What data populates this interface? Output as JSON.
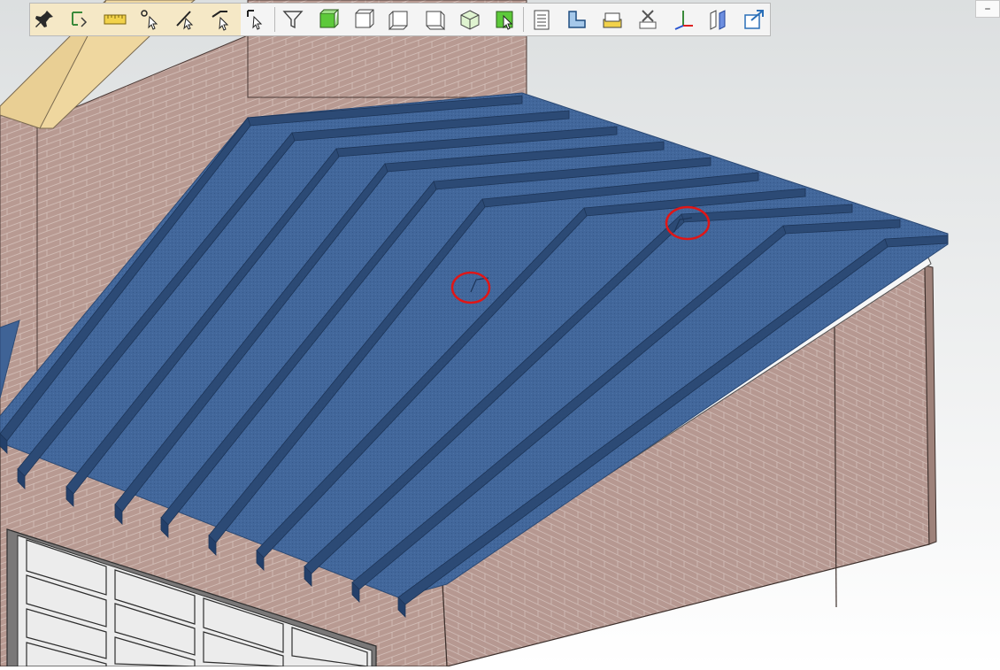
{
  "window": {
    "minimize_label": "–"
  },
  "toolbar": {
    "tools": [
      {
        "id": "pin",
        "icon": "pin-icon"
      },
      {
        "id": "pick-transform",
        "icon": "pick-transform-icon"
      },
      {
        "id": "measure",
        "icon": "ruler-icon"
      },
      {
        "id": "select-point",
        "icon": "select-point-icon"
      },
      {
        "id": "select-edge",
        "icon": "select-edge-icon"
      },
      {
        "id": "select-face",
        "icon": "select-face-icon"
      },
      {
        "id": "select-solid",
        "icon": "select-solid-icon"
      },
      {
        "id": "filter",
        "icon": "filter-icon"
      },
      {
        "id": "view-front",
        "icon": "view-front-icon"
      },
      {
        "id": "view-back",
        "icon": "view-back-icon"
      },
      {
        "id": "view-left",
        "icon": "view-left-icon"
      },
      {
        "id": "view-right",
        "icon": "view-right-icon"
      },
      {
        "id": "view-iso",
        "icon": "view-iso-icon"
      },
      {
        "id": "select-active",
        "icon": "select-active-icon"
      },
      {
        "id": "sheet-list",
        "icon": "sheet-list-icon"
      },
      {
        "id": "stair-section",
        "icon": "section-icon"
      },
      {
        "id": "layer-box",
        "icon": "layer-box-icon"
      },
      {
        "id": "clear-section",
        "icon": "clear-section-icon"
      },
      {
        "id": "axes",
        "icon": "axes-icon"
      },
      {
        "id": "mirror",
        "icon": "mirror-icon"
      },
      {
        "id": "export-view",
        "icon": "export-icon"
      }
    ]
  },
  "scene": {
    "colors": {
      "rafter": "#3f6396",
      "rafter_dark": "#2c4a75",
      "rafter_light": "#5a7fb3",
      "brick": "#b89a92",
      "brick_dark": "#a88a82",
      "roof_deck": "#e9cf94",
      "background_top": "#dcdfe0",
      "background_bottom": "#ffffff",
      "highlight": "#e01616"
    }
  }
}
